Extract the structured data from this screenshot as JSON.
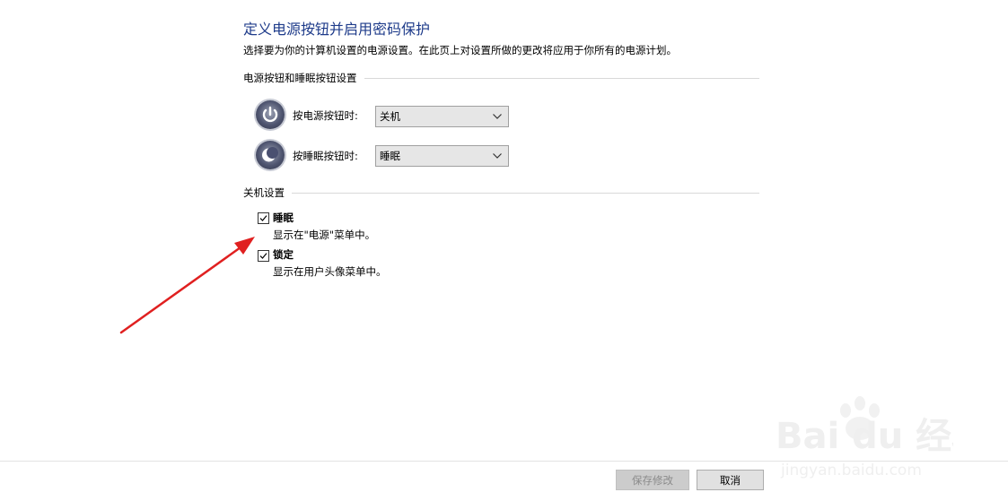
{
  "window": {
    "title": "定义电源按钮并启用密码保护",
    "description": "选择要为你的计算机设置的电源设置。在此页上对设置所做的更改将应用于你所有的电源计划。"
  },
  "power_section": {
    "heading": "电源按钮和睡眠按钮设置",
    "rows": [
      {
        "label": "按电源按钮时:",
        "value": "关机",
        "icon": "power-icon"
      },
      {
        "label": "按睡眠按钮时:",
        "value": "睡眠",
        "icon": "sleep-moon-icon"
      }
    ]
  },
  "shutdown_section": {
    "heading": "关机设置",
    "options": [
      {
        "label": "睡眠",
        "checked": true,
        "description": "显示在\"电源\"菜单中。"
      },
      {
        "label": "锁定",
        "checked": true,
        "description": "显示在用户头像菜单中。"
      }
    ]
  },
  "footer": {
    "save_label": "保存修改",
    "cancel_label": "取消"
  },
  "annotation": {
    "arrow_color": "#e02020"
  },
  "watermark": {
    "brand": "Bai du 经验",
    "url": "jingyan.baidu.com"
  }
}
